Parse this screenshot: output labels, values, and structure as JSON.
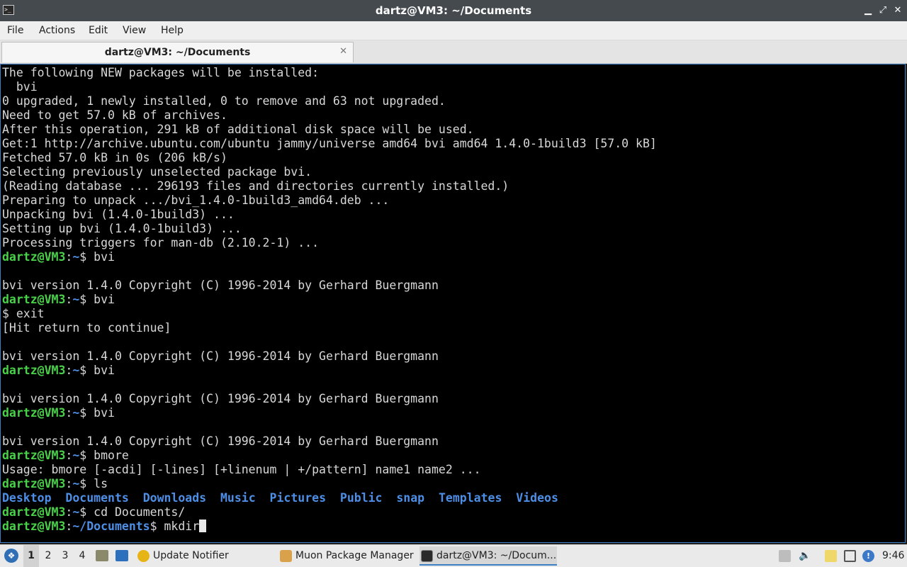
{
  "window": {
    "title": "dartz@VM3: ~/Documents",
    "minimize_glyph": "▁",
    "maximize_glyph": "⤢",
    "close_glyph": "✕"
  },
  "menu": [
    "File",
    "Actions",
    "Edit",
    "View",
    "Help"
  ],
  "tab": {
    "label": "dartz@VM3: ~/Documents",
    "close_glyph": "✕"
  },
  "terminal": {
    "prompt_user": "dartz@VM3",
    "lines": [
      "The following NEW packages will be installed:",
      "  bvi",
      "0 upgraded, 1 newly installed, 0 to remove and 63 not upgraded.",
      "Need to get 57.0 kB of archives.",
      "After this operation, 291 kB of additional disk space will be used.",
      "Get:1 http://archive.ubuntu.com/ubuntu jammy/universe amd64 bvi amd64 1.4.0-1build3 [57.0 kB]",
      "Fetched 57.0 kB in 0s (206 kB/s)",
      "Selecting previously unselected package bvi.",
      "(Reading database ... 296193 files and directories currently installed.)",
      "Preparing to unpack .../bvi_1.4.0-1build3_amd64.deb ...",
      "Unpacking bvi (1.4.0-1build3) ...",
      "Setting up bvi (1.4.0-1build3) ...",
      "Processing triggers for man-db (2.10.2-1) ...",
      {
        "prompt": "~",
        "cmd": "bvi"
      },
      "",
      "bvi version 1.4.0 Copyright (C) 1996-2014 by Gerhard Buergmann",
      {
        "prompt": "~",
        "cmd": "bvi"
      },
      "$ exit",
      "[Hit return to continue]",
      "",
      "bvi version 1.4.0 Copyright (C) 1996-2014 by Gerhard Buergmann",
      {
        "prompt": "~",
        "cmd": "bvi"
      },
      "",
      "bvi version 1.4.0 Copyright (C) 1996-2014 by Gerhard Buergmann",
      {
        "prompt": "~",
        "cmd": "bvi"
      },
      "",
      "bvi version 1.4.0 Copyright (C) 1996-2014 by Gerhard Buergmann",
      {
        "prompt": "~",
        "cmd": "bmore"
      },
      "Usage: bmore [-acdi] [-lines] [+linenum | +/pattern] name1 name2 ...",
      {
        "prompt": "~",
        "cmd": "ls"
      },
      {
        "dirs": [
          "Desktop",
          "Documents",
          "Downloads",
          "Music",
          "Pictures",
          "Public",
          "snap",
          "Templates",
          "Videos"
        ]
      },
      {
        "prompt": "~",
        "cmd": "cd Documents/"
      },
      {
        "prompt": "~/Documents",
        "cmd": "mkdir",
        "cursor": true
      }
    ]
  },
  "taskbar": {
    "workspaces": [
      "1",
      "2",
      "3",
      "4"
    ],
    "active_workspace": "1",
    "tasks": [
      {
        "label": "Update Notifier",
        "icon": "update-notifier-icon"
      },
      {
        "label": "Muon Package Manager",
        "icon": "package-manager-icon"
      },
      {
        "label": "dartz@VM3: ~/Docum...",
        "icon": "terminal-icon",
        "active": true
      }
    ],
    "clock": "9:46"
  },
  "colors": {
    "prompt_user": "#4ad14a",
    "prompt_path": "#4d8fe6",
    "terminal_bg": "#000000",
    "terminal_fg": "#d8d8d8"
  }
}
